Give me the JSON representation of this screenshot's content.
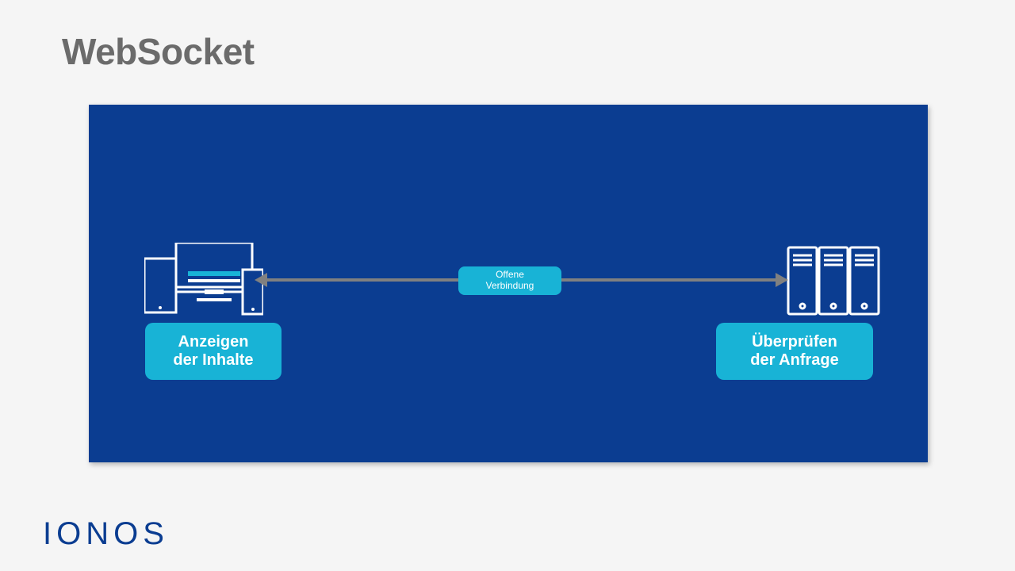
{
  "title": "WebSocket",
  "diagram": {
    "center_badge_line1": "Offene",
    "center_badge_line2": "Verbindung",
    "left_badge_line1": "Anzeigen",
    "left_badge_line2": "der Inhalte",
    "right_badge_line1": "Überprüfen",
    "right_badge_line2": "der Anfrage"
  },
  "logo": "IONOS",
  "colors": {
    "panel_bg": "#0b3d91",
    "badge_bg": "#18b3d6",
    "title_color": "#6b6b6b",
    "arrow_color": "#808080"
  }
}
